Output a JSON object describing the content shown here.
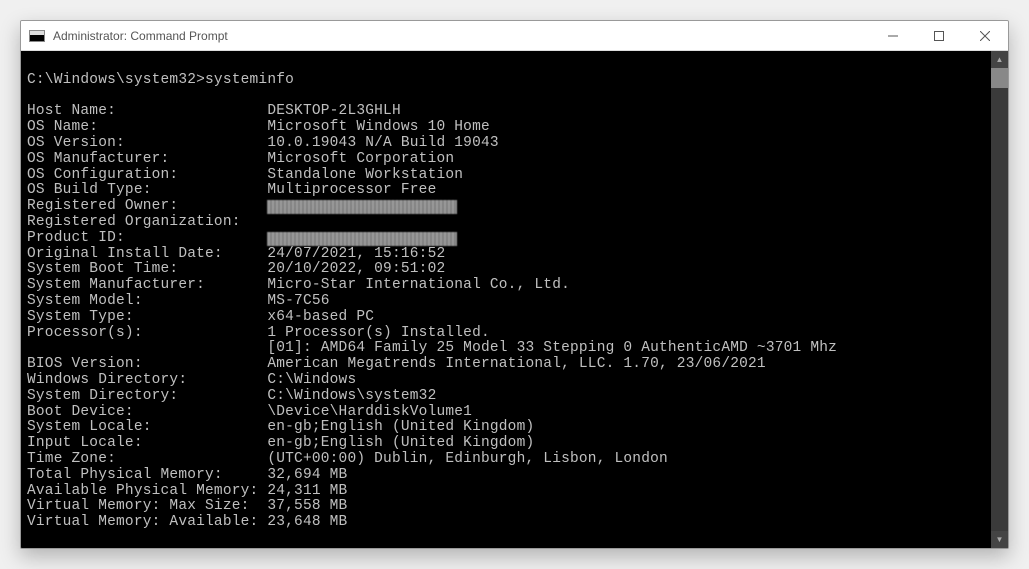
{
  "window": {
    "title": "Administrator: Command Prompt"
  },
  "prompt": {
    "path": "C:\\Windows\\system32>",
    "command": "systeminfo"
  },
  "sysinfo": {
    "label_col_width": 27,
    "rows": [
      {
        "label": "Host Name:",
        "value": "DESKTOP-2L3GHLH"
      },
      {
        "label": "OS Name:",
        "value": "Microsoft Windows 10 Home"
      },
      {
        "label": "OS Version:",
        "value": "10.0.19043 N/A Build 19043"
      },
      {
        "label": "OS Manufacturer:",
        "value": "Microsoft Corporation"
      },
      {
        "label": "OS Configuration:",
        "value": "Standalone Workstation"
      },
      {
        "label": "OS Build Type:",
        "value": "Multiprocessor Free"
      },
      {
        "label": "Registered Owner:",
        "value": "",
        "redacted": true,
        "redactWidth": "w1"
      },
      {
        "label": "Registered Organization:",
        "value": ""
      },
      {
        "label": "Product ID:",
        "value": "",
        "redacted": true,
        "redactWidth": "w2"
      },
      {
        "label": "Original Install Date:",
        "value": "24/07/2021, 15:16:52"
      },
      {
        "label": "System Boot Time:",
        "value": "20/10/2022, 09:51:02"
      },
      {
        "label": "System Manufacturer:",
        "value": "Micro-Star International Co., Ltd."
      },
      {
        "label": "System Model:",
        "value": "MS-7C56"
      },
      {
        "label": "System Type:",
        "value": "x64-based PC"
      },
      {
        "label": "Processor(s):",
        "value": "1 Processor(s) Installed."
      },
      {
        "label": "",
        "value": "[01]: AMD64 Family 25 Model 33 Stepping 0 AuthenticAMD ~3701 Mhz"
      },
      {
        "label": "BIOS Version:",
        "value": "American Megatrends International, LLC. 1.70, 23/06/2021"
      },
      {
        "label": "Windows Directory:",
        "value": "C:\\Windows"
      },
      {
        "label": "System Directory:",
        "value": "C:\\Windows\\system32"
      },
      {
        "label": "Boot Device:",
        "value": "\\Device\\HarddiskVolume1"
      },
      {
        "label": "System Locale:",
        "value": "en-gb;English (United Kingdom)"
      },
      {
        "label": "Input Locale:",
        "value": "en-gb;English (United Kingdom)"
      },
      {
        "label": "Time Zone:",
        "value": "(UTC+00:00) Dublin, Edinburgh, Lisbon, London"
      },
      {
        "label": "Total Physical Memory:",
        "value": "32,694 MB"
      },
      {
        "label": "Available Physical Memory:",
        "value": "24,311 MB"
      },
      {
        "label": "Virtual Memory: Max Size:",
        "value": "37,558 MB"
      },
      {
        "label": "Virtual Memory: Available:",
        "value": "23,648 MB"
      }
    ]
  }
}
